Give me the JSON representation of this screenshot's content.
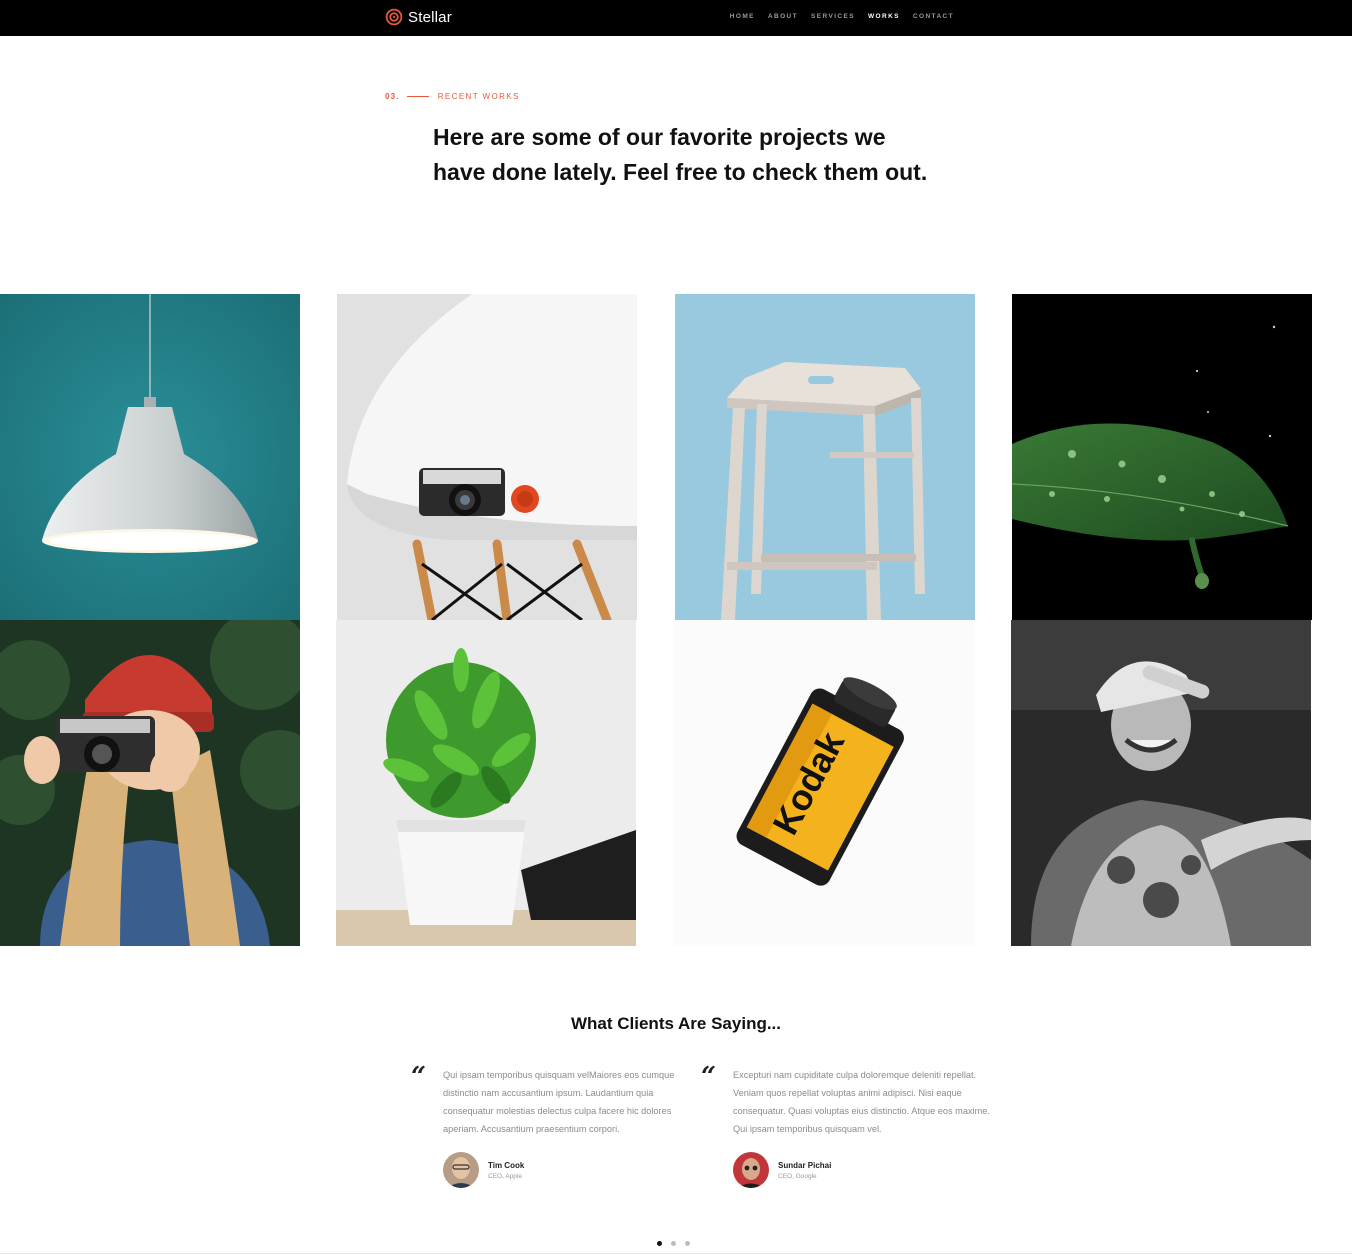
{
  "brand": {
    "name": "Stellar",
    "accent": "#e8593a"
  },
  "nav": [
    {
      "label": "HOME"
    },
    {
      "label": "ABOUT"
    },
    {
      "label": "SERVICES"
    },
    {
      "label": "WORKS",
      "active": true
    },
    {
      "label": "CONTACT"
    }
  ],
  "section": {
    "number": "03.",
    "title": "RECENT WORKS",
    "headline": "Here are some of our favorite projects we have done lately. Feel free to check them out."
  },
  "works": [
    {
      "subject": "pendant lamp on teal wall"
    },
    {
      "subject": "camera on white chair"
    },
    {
      "subject": "wooden stool on blue"
    },
    {
      "subject": "wet leaf on black"
    },
    {
      "subject": "woman with camera and red beanie"
    },
    {
      "subject": "potted plant"
    },
    {
      "subject": "film canister",
      "label": "Kodak"
    },
    {
      "subject": "smiling man in cap"
    }
  ],
  "testimonials": {
    "title": "What Clients Are Saying...",
    "items": [
      {
        "quote": "Qui ipsam temporibus quisquam velMaiores eos cumque distinctio nam accusantium ipsum. Laudantium quia consequatur molestias delectus culpa facere hic dolores aperiam. Accusantium praesentium corpori.",
        "name": "Tim Cook",
        "role": "CEO, Apple"
      },
      {
        "quote": "Excepturi nam cupiditate culpa doloremque deleniti repellat. Veniam quos repellat voluptas animi adipisci. Nisi eaque consequatur. Quasi voluptas eius distinctio. Atque eos maxime. Qui ipsam temporibus quisquam vel.",
        "name": "Sundar Pichai",
        "role": "CEO, Google"
      }
    ],
    "pagination": {
      "count": 3,
      "active": 1
    }
  }
}
